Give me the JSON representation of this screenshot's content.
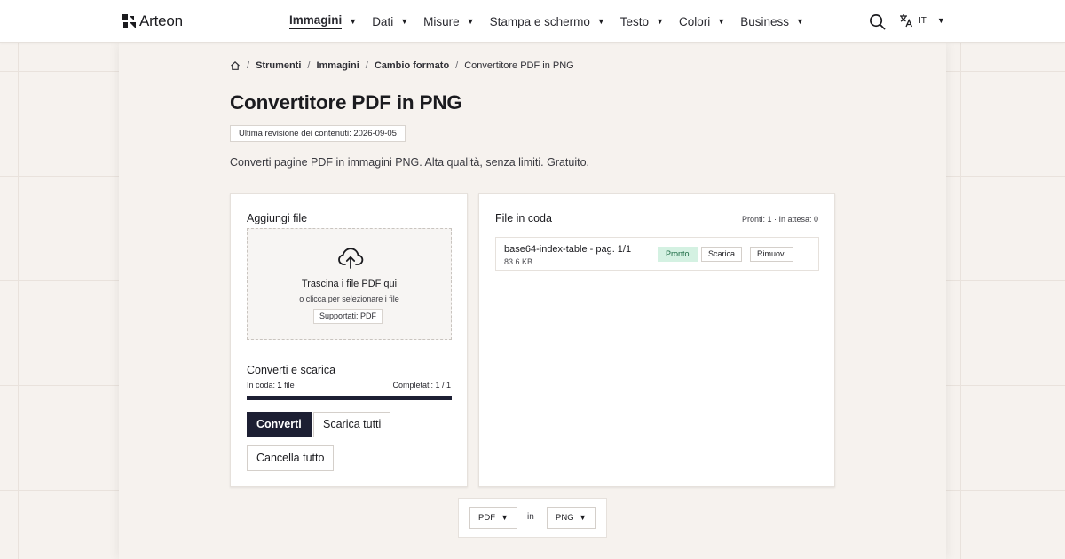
{
  "header": {
    "logo_text": "Arteon",
    "nav": [
      {
        "label": "Immagini",
        "active": true
      },
      {
        "label": "Dati"
      },
      {
        "label": "Misure"
      },
      {
        "label": "Stampa e schermo"
      },
      {
        "label": "Testo"
      },
      {
        "label": "Colori"
      },
      {
        "label": "Business"
      }
    ],
    "nav_caret": "▼",
    "language": "IT",
    "icons": {
      "search": "search-icon",
      "language": "translate-icon",
      "logo": "logo-icon"
    }
  },
  "breadcrumb": {
    "home_icon": "home-icon",
    "separator": "/",
    "items": [
      "Strumenti",
      "Immagini",
      "Cambio formato"
    ],
    "current": "Convertitore PDF in PNG"
  },
  "page": {
    "title": "Convertitore PDF in PNG",
    "revision": "Ultima revisione dei contenuti: 2026-09-05",
    "description": "Converti pagine PDF in immagini PNG. Alta qualità, senza limiti. Gratuito."
  },
  "upload": {
    "title": "Aggiungi file",
    "icon": "cloud-upload-icon",
    "drop_title": "Trascina i file PDF qui",
    "drop_subtitle": "o clicca per selezionare i file",
    "supported": "Supportati: PDF"
  },
  "convert": {
    "title": "Converti e scarica",
    "queue_label": "In coda:",
    "queue_count": "1",
    "queue_unit": "file",
    "completed": "Completati: 1 / 1",
    "progress": 1.0,
    "convert_button": "Converti",
    "download_all_button": "Scarica tutti",
    "clear_button": "Cancella tutto"
  },
  "queue": {
    "title": "File in coda",
    "status": "Pronti: 1 · In attesa: 0",
    "files": [
      {
        "name": "base64-index-table - pag. 1/1",
        "size": "83.6 KB",
        "status": "Pronto",
        "download_label": "Scarica",
        "remove_label": "Rimuovi"
      }
    ]
  },
  "format": {
    "from": "PDF",
    "connector": "in",
    "to": "PNG",
    "caret": "▼"
  },
  "colors": {
    "primary": "#1d1f33",
    "ready_bg": "#d4f1e2",
    "ready_text": "#1c6b44",
    "page_bg": "#f6f2ee"
  }
}
